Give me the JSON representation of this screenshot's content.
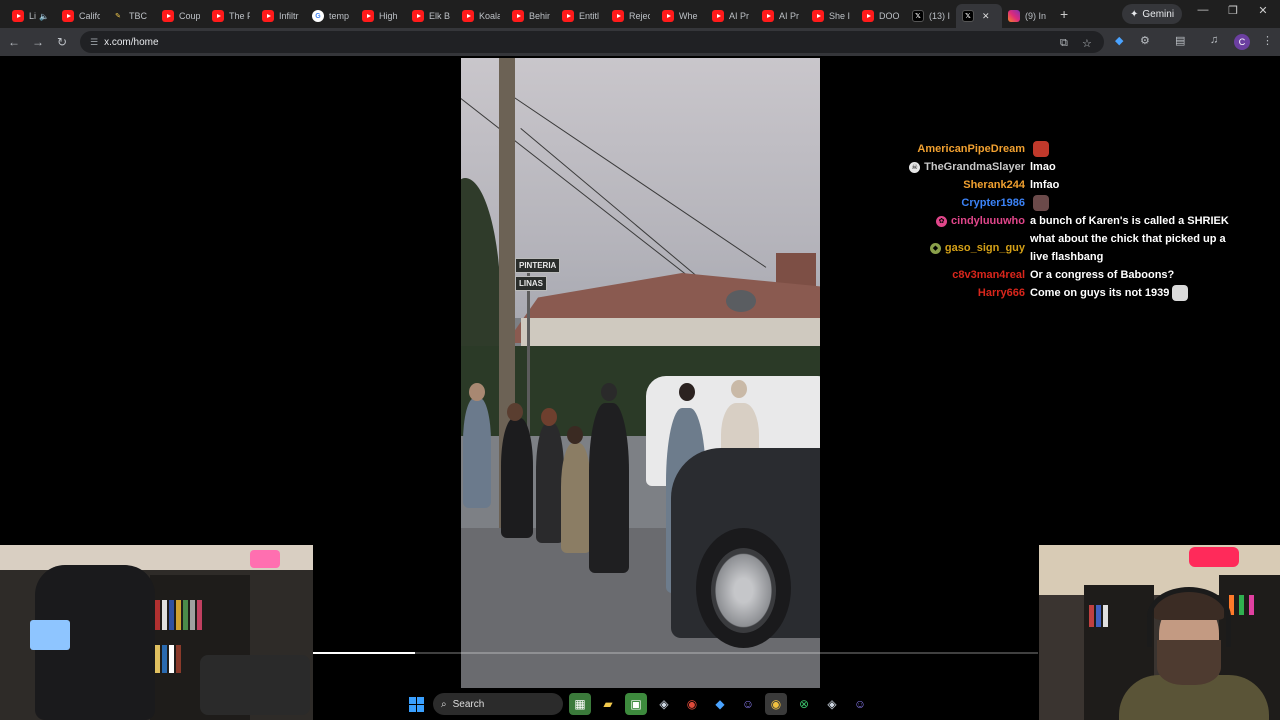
{
  "browser": {
    "tabs": [
      {
        "label": "Li",
        "icon": "youtube-icon"
      },
      {
        "label": "Califo",
        "icon": "youtube-icon"
      },
      {
        "label": "TBC C",
        "icon": "pencil-icon"
      },
      {
        "label": "Coup",
        "icon": "youtube-icon"
      },
      {
        "label": "The F",
        "icon": "youtube-icon"
      },
      {
        "label": "Infiltr",
        "icon": "youtube-icon"
      },
      {
        "label": "temp",
        "icon": "google-icon"
      },
      {
        "label": "High",
        "icon": "youtube-icon"
      },
      {
        "label": "Elk B",
        "icon": "youtube-icon"
      },
      {
        "label": "Koala",
        "icon": "youtube-icon"
      },
      {
        "label": "Behin",
        "icon": "youtube-icon"
      },
      {
        "label": "Entitl",
        "icon": "youtube-icon"
      },
      {
        "label": "Rejec",
        "icon": "youtube-icon"
      },
      {
        "label": "Whe",
        "icon": "youtube-icon"
      },
      {
        "label": "AI Pr",
        "icon": "youtube-icon"
      },
      {
        "label": "AI Pr",
        "icon": "youtube-icon"
      },
      {
        "label": "She I",
        "icon": "youtube-icon"
      },
      {
        "label": "DOO",
        "icon": "youtube-icon"
      },
      {
        "label": "(13) I",
        "icon": "x-icon"
      }
    ],
    "active_tab": {
      "icon": "x-icon"
    },
    "last_tab": {
      "label": "(9) In",
      "icon": "instagram-icon"
    },
    "gemini_label": "Gemini",
    "url": "x.com/home"
  },
  "video": {
    "sign_top": "PINTERIA",
    "sign_bottom": "LINAS",
    "progress": 0.14
  },
  "chat": {
    "messages": [
      {
        "user": "AmericanPipeDream",
        "user_color": "#f0a030",
        "badge": "",
        "text": "",
        "emote": "#c0392b"
      },
      {
        "user": "TheGrandmaSlayer",
        "user_color": "#c8c8c8",
        "badge": "skull",
        "text": "lmao",
        "emote": ""
      },
      {
        "user": "Sherank244",
        "user_color": "#f0a030",
        "badge": "",
        "text": "lmfao",
        "emote": ""
      },
      {
        "user": "Crypter1986",
        "user_color": "#3b82f6",
        "badge": "",
        "text": "",
        "emote": "#6b4a4a"
      },
      {
        "user": "cindyluuuwho",
        "user_color": "#e0468a",
        "badge": "candy",
        "text": "a bunch of Karen's is called a SHRIEK",
        "emote": ""
      },
      {
        "user": "gaso_sign_guy",
        "user_color": "#d4a017",
        "badge": "gem",
        "text": "what about the chick that picked up a live flashbang",
        "emote": ""
      },
      {
        "user": "c8v3man4real",
        "user_color": "#d9261c",
        "badge": "",
        "text": "Or a congress of Baboons?",
        "emote": ""
      },
      {
        "user": "Harry666",
        "user_color": "#d9261c",
        "badge": "",
        "text": "Come on guys its not 1939",
        "emote": "#d9d9d9"
      }
    ]
  },
  "taskbar": {
    "search_label": "Search",
    "icons": [
      "widgets-icon",
      "file-explorer-icon",
      "minecraft-icon",
      "steam-icon",
      "chrome-icon",
      "app-icon",
      "discord-icon",
      "chrome-icon",
      "xbox-icon",
      "steam-icon",
      "discord-icon"
    ]
  }
}
